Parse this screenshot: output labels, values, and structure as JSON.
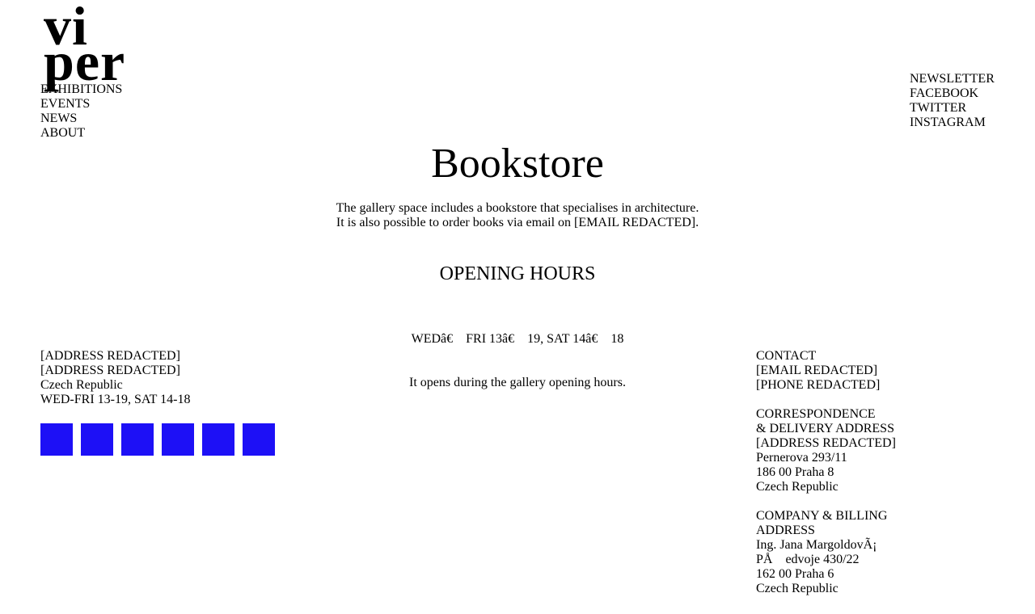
{
  "logo": {
    "line1": "vi",
    "line2": "per"
  },
  "main_nav": [
    {
      "label": "EXHIBITIONS"
    },
    {
      "label": "EVENTS"
    },
    {
      "label": "NEWS"
    },
    {
      "label": "ABOUT"
    }
  ],
  "social_nav": [
    {
      "label": "NEWSLETTER"
    },
    {
      "label": "FACEBOOK"
    },
    {
      "label": "TWITTER"
    },
    {
      "label": "INSTAGRAM"
    }
  ],
  "page": {
    "title": "Bookstore",
    "intro_line1": "The gallery space includes a bookstore that specialises in architecture.",
    "intro_line2": "It is also possible to order books via email on [EMAIL REDACTED]."
  },
  "opening_hours": {
    "heading": "OPENING HOURS",
    "line1": "WEDâ€    FRI 13â€    19, SAT 14â€    18",
    "line2": "It opens during the gallery opening hours."
  },
  "footer_left": {
    "address1": "[ADDRESS REDACTED]",
    "address2": "[ADDRESS REDACTED]",
    "country": "Czech Republic",
    "hours": "WED-FRI 13-19, SAT 14-18",
    "social_icons": [
      "social-icon",
      "social-icon",
      "social-icon",
      "social-icon",
      "social-icon",
      "social-icon"
    ],
    "icon_color": "#1d10f6"
  },
  "footer_right": {
    "contact": {
      "heading": "CONTACT",
      "email": "[EMAIL REDACTED]",
      "phone": "[PHONE REDACTED]"
    },
    "correspondence": {
      "heading1": "CORRESPONDENCE",
      "heading2": "& DELIVERY ADDRESS",
      "line1": "[ADDRESS REDACTED]",
      "line2": "Pernerova 293/11",
      "line3": "186 00 Praha 8",
      "line4": "Czech Republic"
    },
    "billing": {
      "heading1": "COMPANY & BILLING",
      "heading2": "ADDRESS",
      "line1": "Ing. Jana MargoldovÃ¡",
      "line2": "PÅ    edvoje 430/22",
      "line3": "162 00 Praha 6",
      "line4": "Czech Republic"
    }
  }
}
